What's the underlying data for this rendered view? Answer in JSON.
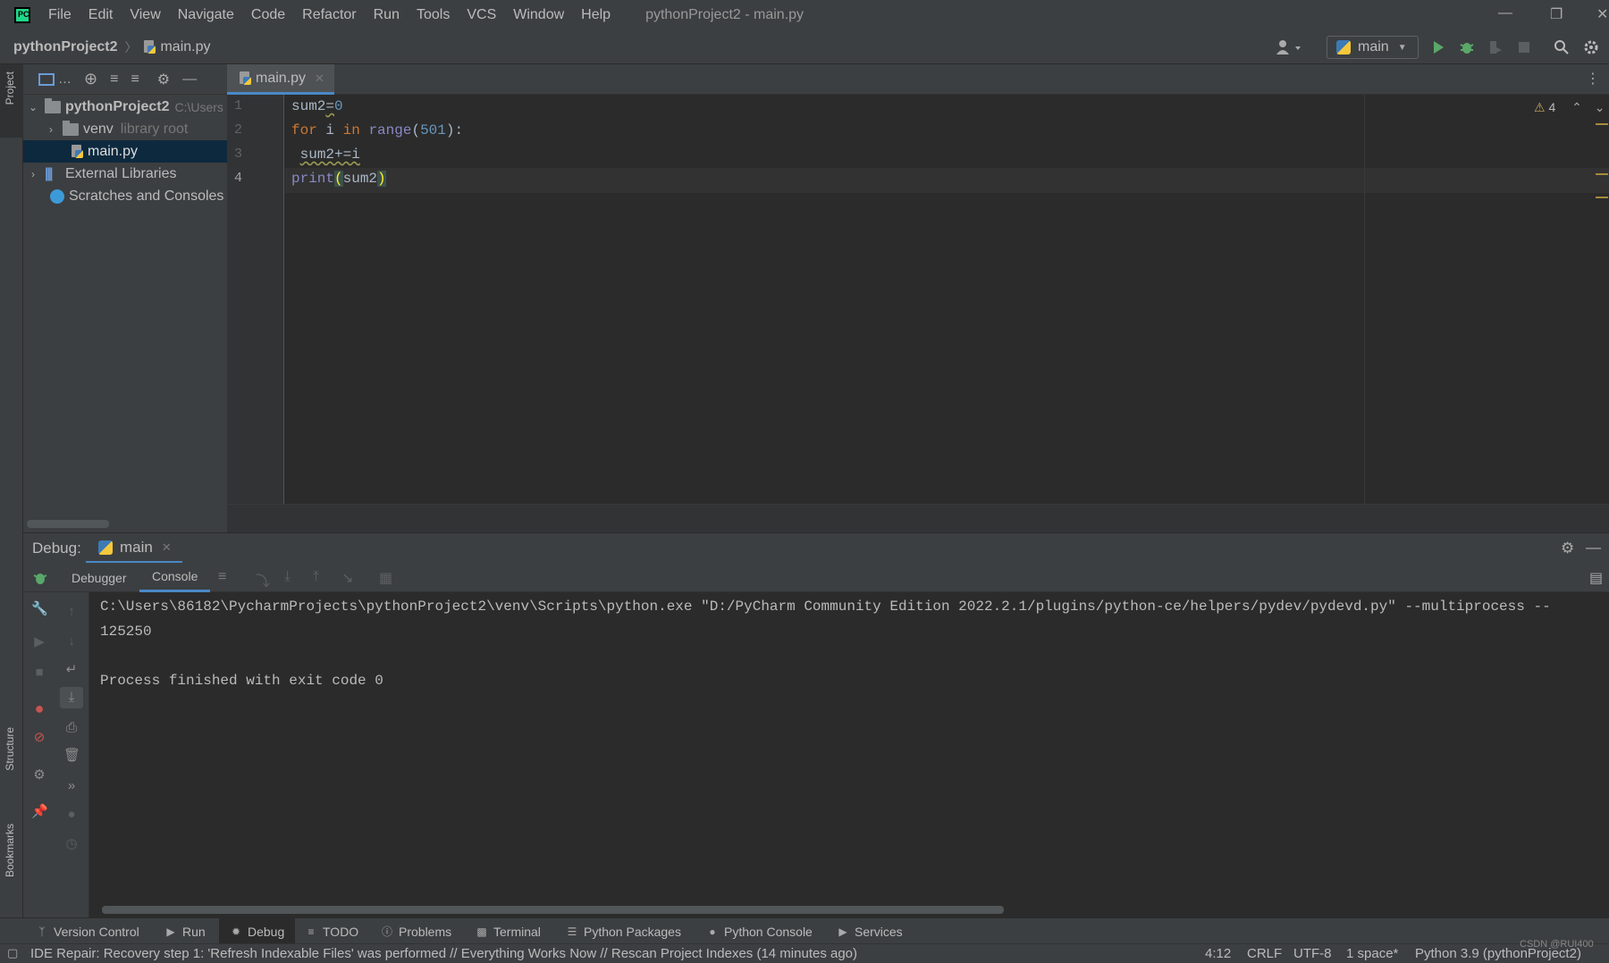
{
  "titlebar": {
    "menu": [
      "File",
      "Edit",
      "View",
      "Navigate",
      "Code",
      "Refactor",
      "Run",
      "Tools",
      "VCS",
      "Window",
      "Help"
    ],
    "window_title": "pythonProject2 - main.py"
  },
  "navbar": {
    "project": "pythonProject2",
    "file": "main.py",
    "run_config": "main"
  },
  "side_labels": {
    "project": "Project",
    "structure": "Structure",
    "bookmarks": "Bookmarks"
  },
  "project_tree": [
    {
      "label": "pythonProject2",
      "hint": "C:\\Users",
      "type": "folder",
      "expanded": true
    },
    {
      "label": "venv",
      "hint": "library root",
      "type": "folder",
      "expanded": false
    },
    {
      "label": "main.py",
      "hint": "",
      "type": "file",
      "selected": true
    },
    {
      "label": "External Libraries",
      "hint": "",
      "type": "libs",
      "expanded": false
    },
    {
      "label": "Scratches and Consoles",
      "hint": "",
      "type": "scratch"
    }
  ],
  "editor": {
    "tab": "main.py",
    "line_numbers": [
      "1",
      "2",
      "3",
      "4"
    ],
    "warnings": "4",
    "code": {
      "l1_var": "sum2",
      "l1_eq": "=",
      "l1_num": "0",
      "l2_for": "for",
      "l2_i": " i ",
      "l2_in": "in",
      "l2_sp": " ",
      "l2_range": "range",
      "l2_open": "(",
      "l2_num": "501",
      "l2_close": "):",
      "l3_sp": " ",
      "l3_stmt": "sum2+=i",
      "l4_print": "print",
      "l4_open": "(",
      "l4_arg": "sum2",
      "l4_close": ")"
    }
  },
  "debug": {
    "label": "Debug:",
    "tab": "main",
    "subtabs": {
      "debugger": "Debugger",
      "console": "Console"
    },
    "console_lines": [
      "C:\\Users\\86182\\PycharmProjects\\pythonProject2\\venv\\Scripts\\python.exe \"D:/PyCharm Community Edition 2022.2.1/plugins/python-ce/helpers/pydev/pydevd.py\" --multiprocess --",
      "125250",
      "",
      "Process finished with exit code 0"
    ]
  },
  "bottom_tools": [
    "Version Control",
    "Run",
    "Debug",
    "TODO",
    "Problems",
    "Terminal",
    "Python Packages",
    "Python Console",
    "Services"
  ],
  "status": {
    "message": "IDE Repair: Recovery step 1: 'Refresh Indexable Files' was performed // Everything Works Now // Rescan Project Indexes (14 minutes ago)",
    "position": "4:12",
    "line_sep": "CRLF",
    "encoding": "UTF-8",
    "indent": "1 space*",
    "interpreter": "Python 3.9 (pythonProject2)",
    "watermark": "CSDN @RUI400"
  },
  "colors": {
    "keyword": "#cc7832",
    "number": "#6897bb",
    "builtin": "#8888c6",
    "accent": "#4a88c7",
    "run_green": "#59a869"
  }
}
